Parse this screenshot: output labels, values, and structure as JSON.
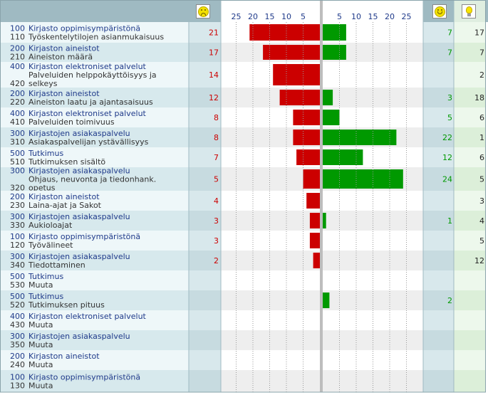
{
  "header": {
    "sad_icon": "sad-face-icon",
    "happy_icon": "happy-face-icon",
    "idea_icon": "light-bulb-icon",
    "left_axis_ticks": [
      "25",
      "20",
      "15",
      "10",
      "5"
    ],
    "right_axis_ticks": [
      "5",
      "10",
      "15",
      "20",
      "25"
    ]
  },
  "colors": {
    "negative_bar": "#cc0000",
    "positive_bar": "#009900",
    "negative_count": "#cc0000",
    "positive_count": "#009900",
    "label_blue": "#1f3a8a",
    "row_label_a": "#eef7f9",
    "row_label_b": "#d7e9ed",
    "count_col_a": "#d8e8ec",
    "count_col_b": "#c7dbe0",
    "chart_a": "#ffffff",
    "chart_b": "#eeeeee",
    "idea_a": "#edf8ec",
    "idea_b": "#dcefd9",
    "header_bg": "#9fbac2"
  },
  "chart_data": {
    "type": "bar",
    "xlim": [
      25,
      25
    ],
    "rows": [
      {
        "group_code": "100",
        "group": "Kirjasto oppimisympäristönä",
        "code": "110",
        "item": [
          "Työskentelytilojen asianmukaisuus"
        ],
        "negative": 21,
        "positive": 7,
        "ideas": 17
      },
      {
        "group_code": "200",
        "group": "Kirjaston aineistot",
        "code": "210",
        "item": [
          "Aineiston määrä"
        ],
        "negative": 17,
        "positive": 7,
        "ideas": 7
      },
      {
        "group_code": "400",
        "group": "Kirjaston elektroniset palvelut",
        "code": "420",
        "item": [
          "Palveluiden helppokäyttöisyys ja",
          "selkeys"
        ],
        "negative": 14,
        "positive": null,
        "ideas": 2
      },
      {
        "group_code": "200",
        "group": "Kirjaston aineistot",
        "code": "220",
        "item": [
          "Aineiston laatu ja ajantasaisuus"
        ],
        "negative": 12,
        "positive": 3,
        "ideas": 18
      },
      {
        "group_code": "400",
        "group": "Kirjaston elektroniset palvelut",
        "code": "410",
        "item": [
          "Palveluiden toimivuus"
        ],
        "negative": 8,
        "positive": 5,
        "ideas": 6
      },
      {
        "group_code": "300",
        "group": "Kirjastojen asiakaspalvelu",
        "code": "310",
        "item": [
          "Asiakaspalvelijan ystävällisyys"
        ],
        "negative": 8,
        "positive": 22,
        "ideas": 1
      },
      {
        "group_code": "500",
        "group": "Tutkimus",
        "code": "510",
        "item": [
          "Tutkimuksen sisältö"
        ],
        "negative": 7,
        "positive": 12,
        "ideas": 6
      },
      {
        "group_code": "300",
        "group": "Kirjastojen asiakaspalvelu",
        "code": "320",
        "item": [
          "Ohjaus, neuvonta ja tiedonhank.",
          "opetus"
        ],
        "negative": 5,
        "positive": 24,
        "ideas": 5
      },
      {
        "group_code": "200",
        "group": "Kirjaston aineistot",
        "code": "230",
        "item": [
          "Laina-ajat ja Sakot"
        ],
        "negative": 4,
        "positive": null,
        "ideas": 3
      },
      {
        "group_code": "300",
        "group": "Kirjastojen asiakaspalvelu",
        "code": "330",
        "item": [
          "Aukioloajat"
        ],
        "negative": 3,
        "positive": 1,
        "ideas": 4
      },
      {
        "group_code": "100",
        "group": "Kirjasto oppimisympäristönä",
        "code": "120",
        "item": [
          "Työvälineet"
        ],
        "negative": 3,
        "positive": null,
        "ideas": 5
      },
      {
        "group_code": "300",
        "group": "Kirjastojen asiakaspalvelu",
        "code": "340",
        "item": [
          "Tiedottaminen"
        ],
        "negative": 2,
        "positive": null,
        "ideas": 12
      },
      {
        "group_code": "500",
        "group": "Tutkimus",
        "code": "530",
        "item": [
          "Muuta"
        ],
        "negative": null,
        "positive": null,
        "ideas": null
      },
      {
        "group_code": "500",
        "group": "Tutkimus",
        "code": "520",
        "item": [
          "Tutkimuksen pituus"
        ],
        "negative": null,
        "positive": 2,
        "ideas": null
      },
      {
        "group_code": "400",
        "group": "Kirjaston elektroniset palvelut",
        "code": "430",
        "item": [
          "Muuta"
        ],
        "negative": null,
        "positive": null,
        "ideas": null
      },
      {
        "group_code": "300",
        "group": "Kirjastojen asiakaspalvelu",
        "code": "350",
        "item": [
          "Muuta"
        ],
        "negative": null,
        "positive": null,
        "ideas": null
      },
      {
        "group_code": "200",
        "group": "Kirjaston aineistot",
        "code": "240",
        "item": [
          "Muuta"
        ],
        "negative": null,
        "positive": null,
        "ideas": null
      },
      {
        "group_code": "100",
        "group": "Kirjasto oppimisympäristönä",
        "code": "130",
        "item": [
          "Muuta"
        ],
        "negative": null,
        "positive": null,
        "ideas": null
      }
    ]
  }
}
